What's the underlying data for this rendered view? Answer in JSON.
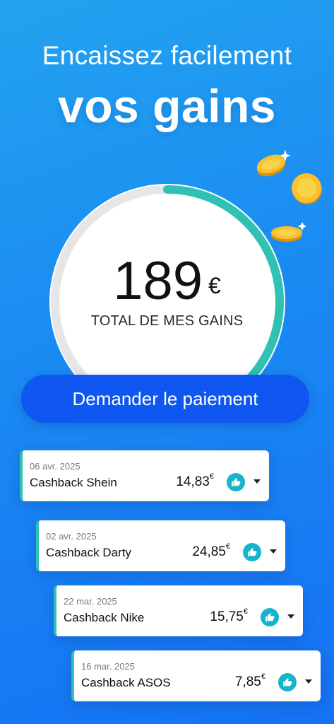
{
  "headline": {
    "line1": "Encaissez facilement",
    "line2": "vos gains"
  },
  "total": {
    "amount": "189",
    "currency": "€",
    "label": "TOTAL DE MES GAINS",
    "progress_fraction": 0.37
  },
  "pay_button": {
    "label": "Demander le paiement"
  },
  "transactions": [
    {
      "date": "06 avr. 2025",
      "title": "Cashback Shein",
      "amount": "14,83",
      "currency": "€",
      "icon": "thumbs-up-icon"
    },
    {
      "date": "02 avr. 2025",
      "title": "Cashback Darty",
      "amount": "24,85",
      "currency": "€",
      "icon": "thumbs-up-icon"
    },
    {
      "date": "22 mar. 2025",
      "title": "Cashback Nike",
      "amount": "15,75",
      "currency": "€",
      "icon": "thumbs-up-icon"
    },
    {
      "date": "16 mar. 2025",
      "title": "Cashback ASOS",
      "amount": "7,85",
      "currency": "€",
      "icon": "thumbs-up-icon"
    }
  ],
  "colors": {
    "background": "#1a8af2",
    "button": "#0f57f0",
    "progress": "#2fc2b3",
    "thumb_badge": "#17b5cc",
    "coin": "#f7b71b"
  }
}
